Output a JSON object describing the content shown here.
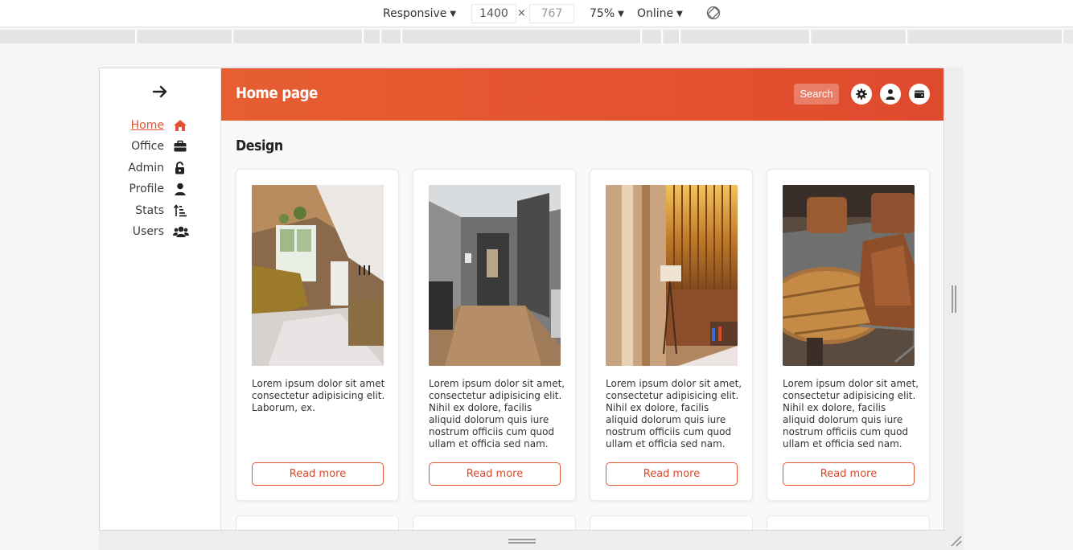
{
  "devtools": {
    "device": "Responsive",
    "width": "1400",
    "times": "×",
    "height": "767",
    "zoom": "75%",
    "network": "Online"
  },
  "sidebar": {
    "items": [
      {
        "label": "Home",
        "icon": "home-icon",
        "active": true
      },
      {
        "label": "Office",
        "icon": "briefcase-icon",
        "active": false
      },
      {
        "label": "Admin",
        "icon": "unlock-icon",
        "active": false
      },
      {
        "label": "Profile",
        "icon": "user-icon",
        "active": false
      },
      {
        "label": "Stats",
        "icon": "sort-amount-icon",
        "active": false
      },
      {
        "label": "Users",
        "icon": "users-icon",
        "active": false
      }
    ]
  },
  "header": {
    "title": "Home page",
    "search_label": "Search"
  },
  "section": {
    "title": "Design"
  },
  "cards": [
    {
      "text": "Lorem ipsum dolor sit amet consectetur adipisicing elit. Laborum, ex.",
      "button": "Read more",
      "image": "rustic living room interior photo"
    },
    {
      "text": "Lorem ipsum dolor sit amet, consectetur adipisicing elit. Nihil ex dolore, facilis aliquid dolorum quis iure nostrum officiis cum quod ullam et officia sed nam.",
      "button": "Read more",
      "image": "modern hallway interior photo"
    },
    {
      "text": "Lorem ipsum dolor sit amet, consectetur adipisicing elit. Nihil ex dolore, facilis aliquid dolorum quis iure nostrum officiis cum quod ullam et officia sed nam.",
      "button": "Read more",
      "image": "hotel bedroom with lamp photo"
    },
    {
      "text": "Lorem ipsum dolor sit amet, consectetur adipisicing elit. Nihil ex dolore, facilis aliquid dolorum quis iure nostrum officiis cum quod ullam et officia sed nam.",
      "button": "Read more",
      "image": "leather chairs and wooden table photo"
    }
  ],
  "colors": {
    "accent": "#e25334",
    "header_start": "#e65e32",
    "header_end": "#de4a2c"
  }
}
